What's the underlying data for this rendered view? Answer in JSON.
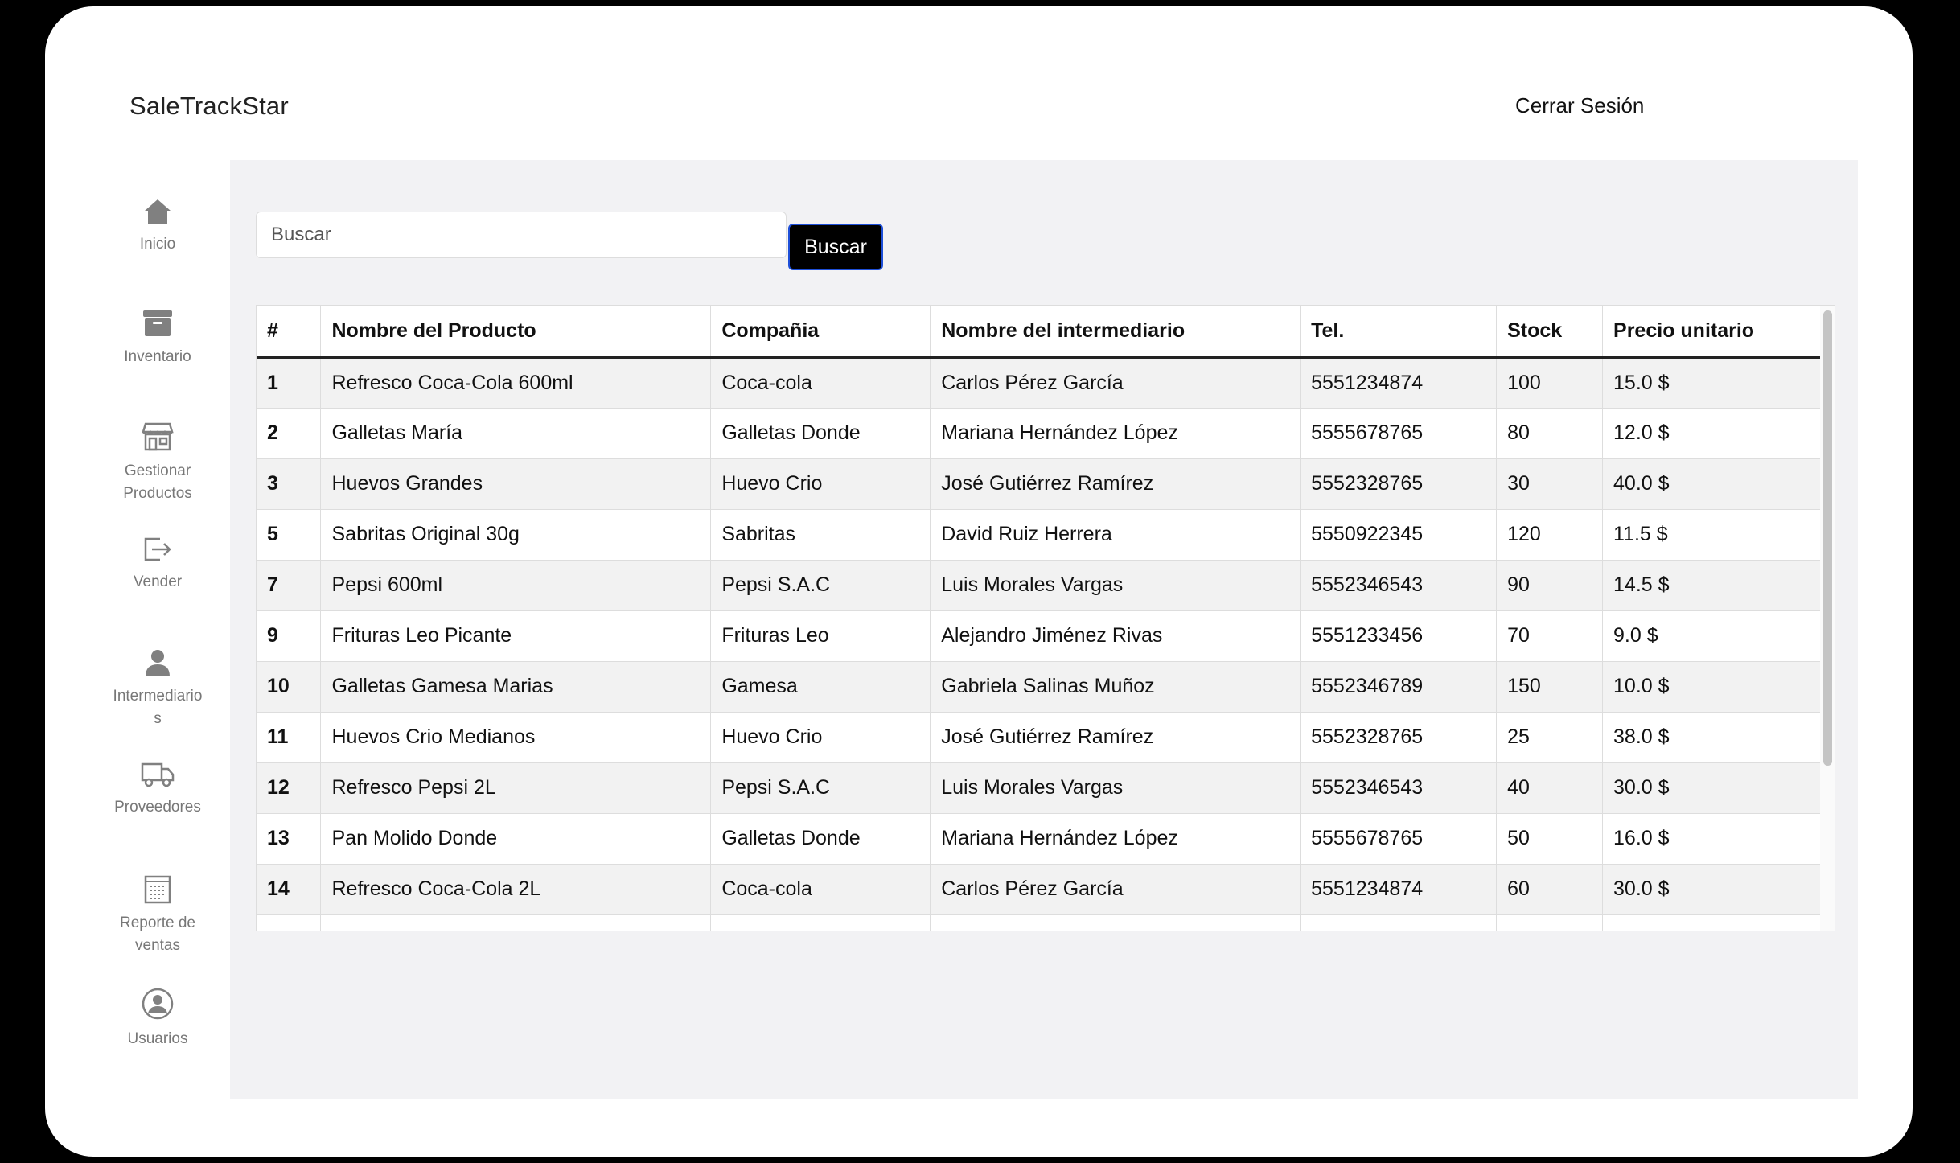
{
  "app": {
    "title": "SaleTrackStar",
    "logout_label": "Cerrar Sesión"
  },
  "sidebar": {
    "items": [
      {
        "label": "Inicio",
        "icon": "home-icon"
      },
      {
        "label": "Inventario",
        "icon": "archive-icon"
      },
      {
        "label": "Gestionar Productos",
        "icon": "store-icon"
      },
      {
        "label": "Vender",
        "icon": "sign-out-icon"
      },
      {
        "label": "Intermediarios",
        "icon": "user-icon"
      },
      {
        "label": "Proveedores",
        "icon": "truck-icon"
      },
      {
        "label": "Reporte de ventas",
        "icon": "report-icon"
      },
      {
        "label": "Usuarios",
        "icon": "user-circle-icon"
      }
    ]
  },
  "search": {
    "placeholder": "Buscar",
    "value": "",
    "button_label": "Buscar"
  },
  "table": {
    "headers": [
      "#",
      "Nombre del Producto",
      "Compañia",
      "Nombre del intermediario",
      "Tel.",
      "Stock",
      "Precio unitario"
    ],
    "rows": [
      [
        "1",
        "Refresco Coca-Cola 600ml",
        "Coca-cola",
        "Carlos Pérez García",
        "5551234874",
        "100",
        "15.0 $"
      ],
      [
        "2",
        "Galletas María",
        "Galletas Donde",
        "Mariana Hernández López",
        "5555678765",
        "80",
        "12.0 $"
      ],
      [
        "3",
        "Huevos Grandes",
        "Huevo Crio",
        "José Gutiérrez Ramírez",
        "5552328765",
        "30",
        "40.0 $"
      ],
      [
        "5",
        "Sabritas Original 30g",
        "Sabritas",
        "David Ruiz Herrera",
        "5550922345",
        "120",
        "11.5 $"
      ],
      [
        "7",
        "Pepsi 600ml",
        "Pepsi S.A.C",
        "Luis Morales Vargas",
        "5552346543",
        "90",
        "14.5 $"
      ],
      [
        "9",
        "Frituras Leo Picante",
        "Frituras Leo",
        "Alejandro Jiménez Rivas",
        "5551233456",
        "70",
        "9.0 $"
      ],
      [
        "10",
        "Galletas Gamesa Marias",
        "Gamesa",
        "Gabriela Salinas Muñoz",
        "5552346789",
        "150",
        "10.0 $"
      ],
      [
        "11",
        "Huevos Crio Medianos",
        "Huevo Crio",
        "José Gutiérrez Ramírez",
        "5552328765",
        "25",
        "38.0 $"
      ],
      [
        "12",
        "Refresco Pepsi 2L",
        "Pepsi S.A.C",
        "Luis Morales Vargas",
        "5552346543",
        "40",
        "30.0 $"
      ],
      [
        "13",
        "Pan Molido Donde",
        "Galletas Donde",
        "Mariana Hernández López",
        "5555678765",
        "50",
        "16.0 $"
      ],
      [
        "14",
        "Refresco Coca-Cola 2L",
        "Coca-cola",
        "Carlos Pérez García",
        "5551234874",
        "60",
        "30.0 $"
      ]
    ]
  }
}
